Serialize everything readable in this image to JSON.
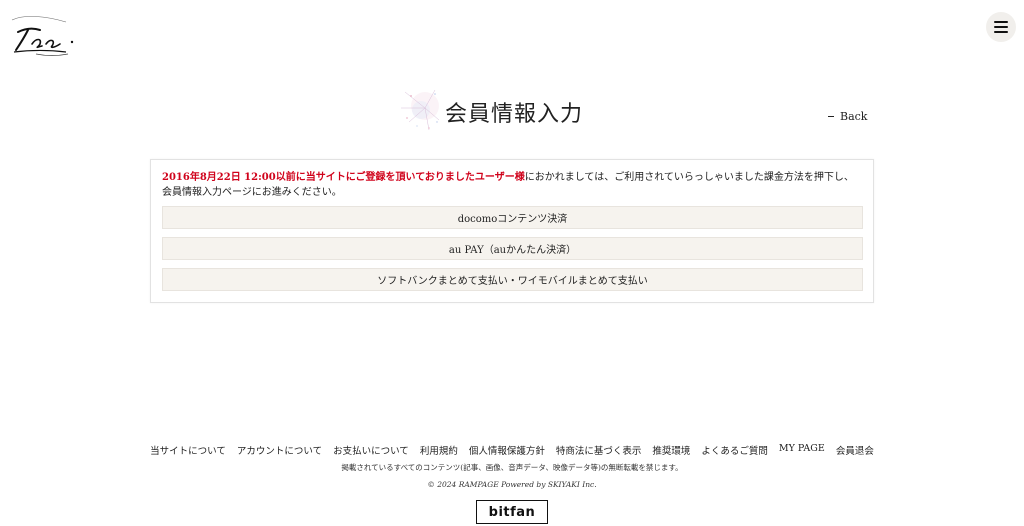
{
  "header": {
    "logo_name": "tec-signature-logo",
    "menu_icon": "hamburger-icon"
  },
  "main": {
    "title": "会員情報入力",
    "back_label": "Back",
    "notice_highlight": "2016年8月22日 12:00以前に当サイトにご登録を頂いておりましたユーザー様",
    "notice_rest": "におかれましては、ご利用されていらっしゃいました課金方法を押下し、会員情報入力ページにお進みください。",
    "payment_options": [
      {
        "label": "docomoコンテンツ決済"
      },
      {
        "label": "au PAY（auかんたん決済）"
      },
      {
        "label": "ソフトバンクまとめて支払い・ワイモバイルまとめて支払い"
      }
    ]
  },
  "footer": {
    "links": [
      {
        "label": "当サイトについて"
      },
      {
        "label": "アカウントについて"
      },
      {
        "label": "お支払いについて"
      },
      {
        "label": "利用規約"
      },
      {
        "label": "個人情報保護方針"
      },
      {
        "label": "特商法に基づく表示"
      },
      {
        "label": "推奨環境"
      },
      {
        "label": "よくあるご質問"
      },
      {
        "label": "MY PAGE"
      },
      {
        "label": "会員退会"
      }
    ],
    "copyright_note": "掲載されているすべてのコンテンツ(記事、画像、音声データ、映像データ等)の無断転載を禁じます。",
    "powered_by": "© 2024 RAMPAGE Powered by SKIYAKI Inc.",
    "bitfan_label": "bitfan"
  },
  "colors": {
    "accent_red": "#d0021b",
    "button_bg": "#f6f3ee",
    "menu_bg": "#f1efec"
  }
}
